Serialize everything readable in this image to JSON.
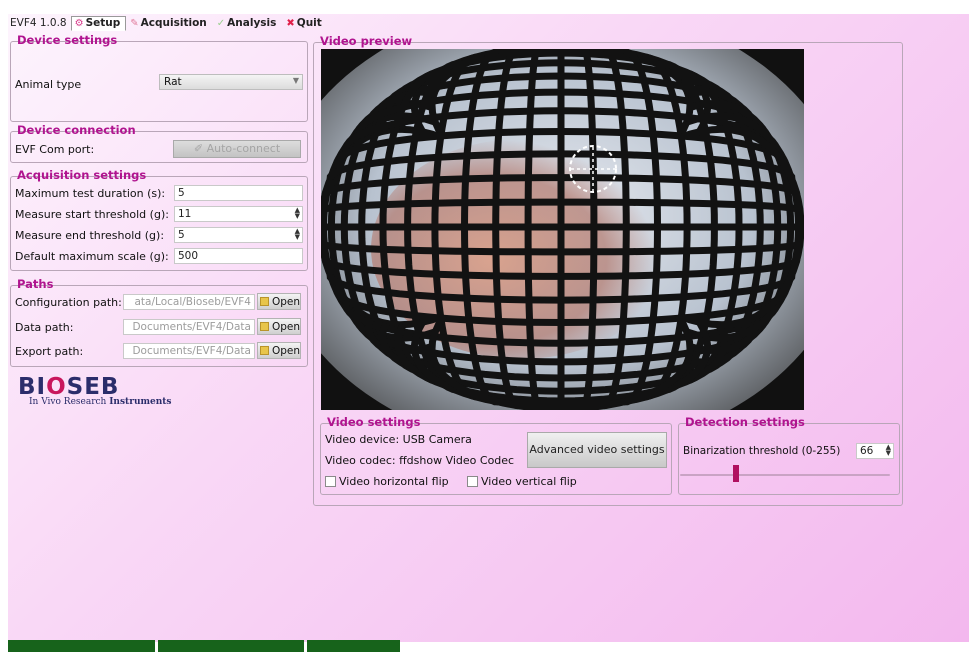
{
  "app": {
    "version": "EVF4 1.0.8"
  },
  "tabs": [
    {
      "label": "Setup",
      "icon": "gear-icon"
    },
    {
      "label": "Acquisition",
      "icon": "pencil-icon"
    },
    {
      "label": "Analysis",
      "icon": "checkmark-icon"
    },
    {
      "label": "Quit",
      "icon": "close-icon"
    }
  ],
  "device_settings": {
    "title": "Device settings",
    "animal_label": "Animal type",
    "animal_value": "Rat"
  },
  "device_connection": {
    "title": "Device connection",
    "port_label": "EVF Com port:",
    "auto_connect": "Auto-connect"
  },
  "acquisition": {
    "title": "Acquisition settings",
    "rows": [
      {
        "label": "Maximum test duration (s):",
        "value": "5"
      },
      {
        "label": "Measure start threshold (g):",
        "value": "11"
      },
      {
        "label": "Measure end threshold (g):",
        "value": "5"
      },
      {
        "label": "Default maximum scale (g):",
        "value": "500"
      }
    ]
  },
  "paths": {
    "title": "Paths",
    "open_label": "Open",
    "rows": [
      {
        "label": "Configuration path:",
        "value": "ata/Local/Bioseb/EVF4"
      },
      {
        "label": "Data path:",
        "value": "Documents/EVF4/Data"
      },
      {
        "label": "Export path:",
        "value": "Documents/EVF4/Data"
      }
    ]
  },
  "logo": {
    "brand_1": "BI",
    "brand_o": "O",
    "brand_2": "SEB",
    "tagline_1": "In Vivo Research ",
    "tagline_2": "Instruments"
  },
  "video_preview": {
    "title": "Video preview"
  },
  "video_settings": {
    "title": "Video settings",
    "device": "Video device: USB Camera",
    "codec": "Video codec:  ffdshow Video Codec",
    "advanced": "Advanced video settings",
    "hflip": "Video horizontal flip",
    "vflip": "Video vertical flip"
  },
  "detection": {
    "title": "Detection settings",
    "threshold_label": "Binarization threshold (0-255)",
    "threshold_value": "66",
    "slider_value": 66,
    "slider_max": 255
  },
  "colors": {
    "accent": "#b0148f",
    "status_green": "#17631b"
  }
}
